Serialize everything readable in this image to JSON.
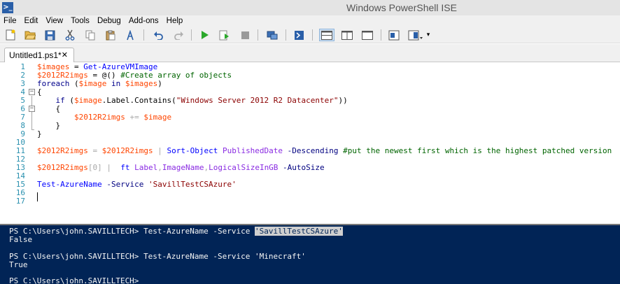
{
  "window": {
    "title": "Windows PowerShell ISE"
  },
  "menu": [
    "File",
    "Edit",
    "View",
    "Tools",
    "Debug",
    "Add-ons",
    "Help"
  ],
  "toolbar_icons": [
    "new-icon",
    "open-icon",
    "save-icon",
    "cut-icon",
    "copy-icon",
    "paste-icon",
    "clear-icon",
    "undo-icon",
    "redo-icon",
    "run-icon",
    "run-selection-icon",
    "stop-icon",
    "remote-icon",
    "powershell-icon",
    "layout-top-icon",
    "layout-right-icon",
    "layout-max-icon",
    "commands-icon",
    "addon-icon"
  ],
  "tab": {
    "label": "Untitled1.ps1*",
    "close": "✕"
  },
  "editor": {
    "line_numbers": [
      "1",
      "2",
      "3",
      "4",
      "5",
      "6",
      "7",
      "8",
      "9",
      "10",
      "11",
      "12",
      "13",
      "14",
      "15",
      "16",
      "17"
    ],
    "l1": {
      "a": "$images",
      "b": " = ",
      "c": "Get-AzureVMImage"
    },
    "l2": {
      "a": "$2012R2imgs",
      "b": " = @() ",
      "c": "#Create array of objects"
    },
    "l3": {
      "a": "foreach",
      "b": " (",
      "c": "$image",
      "d": " in ",
      "e": "$images",
      "f": ")"
    },
    "l4": "{",
    "l5": {
      "a": "    if",
      "b": " (",
      "c": "$image",
      "d": ".Label.Contains(",
      "e": "\"Windows Server 2012 R2 Datacenter\"",
      "f": "))"
    },
    "l6": "    {",
    "l7": {
      "a": "        ",
      "b": "$2012R2imgs",
      "c": " += ",
      "d": "$image"
    },
    "l8": "    }",
    "l9": "}",
    "l11": {
      "a": "$2012R2imgs",
      "b": " = ",
      "c": "$2012R2imgs",
      "d": " | ",
      "e": "Sort-Object",
      "f": " PublishedDate",
      "g": " -Descending",
      "h": " #put the newest first which is the highest patched version"
    },
    "l13": {
      "a": "$2012R2imgs",
      "b": "[0]",
      "c": " |  ",
      "d": "ft",
      "e": " Label",
      "f": ",",
      "g": "ImageName",
      "h": ",",
      "i": "LogicalSizeInGB",
      "j": " -AutoSize"
    },
    "l15": {
      "a": "Test-AzureName",
      "b": " -Service ",
      "c": "'SavillTestCSAzure'"
    }
  },
  "console": {
    "line1_prompt": "PS C:\\Users\\john.SAVILLTECH> ",
    "line1_cmd": "Test-AzureName",
    "line1_param": " -Service ",
    "line1_arg": "'SavillTestCSAzure'",
    "line2": "False",
    "line4_prompt": "PS C:\\Users\\john.SAVILLTECH> ",
    "line4_cmd": "Test-AzureName",
    "line4_param": " -Service ",
    "line4_arg": "'Minecraft'",
    "line5": "True",
    "line7_prompt": "PS C:\\Users\\john.SAVILLTECH>"
  }
}
